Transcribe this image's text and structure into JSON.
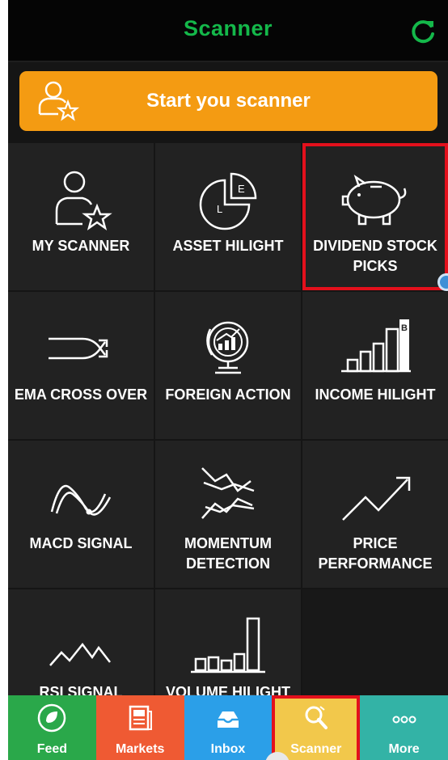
{
  "header": {
    "title": "Scanner",
    "refresh_icon": "refresh-icon"
  },
  "start_button": {
    "label": "Start you scanner",
    "icon": "user-star-icon"
  },
  "tiles": [
    {
      "id": "my-scanner",
      "label": "MY SCANNER",
      "icon": "user-star-icon"
    },
    {
      "id": "asset-hilight",
      "label": "ASSET HILIGHT",
      "icon": "pie-chart-icon"
    },
    {
      "id": "dividend-stock-picks",
      "label": "DIVIDEND STOCK PICKS",
      "icon": "piggy-bank-icon",
      "highlighted": true
    },
    {
      "id": "ema-cross-over",
      "label": "EMA CROSS OVER",
      "icon": "cross-arrows-icon"
    },
    {
      "id": "foreign-action",
      "label": "FOREIGN ACTION",
      "icon": "globe-chart-icon"
    },
    {
      "id": "income-hilight",
      "label": "INCOME HILIGHT",
      "icon": "bar-chart-icon"
    },
    {
      "id": "macd-signal",
      "label": "MACD SIGNAL",
      "icon": "sine-wave-icon"
    },
    {
      "id": "momentum-detection",
      "label": "MOMENTUM DETECTION",
      "icon": "momentum-icon"
    },
    {
      "id": "price-performance",
      "label": "PRICE PERFORMANCE",
      "icon": "trend-up-icon"
    },
    {
      "id": "rsi-signal",
      "label": "RSI SIGNAL",
      "icon": "zigzag-icon"
    },
    {
      "id": "volume-hilight",
      "label": "VOLUME HILIGHT",
      "icon": "volume-bars-icon"
    }
  ],
  "tabs": [
    {
      "label": "Feed",
      "icon": "leaf-icon",
      "color": "#2aa84a"
    },
    {
      "label": "Markets",
      "icon": "newspaper-icon",
      "color": "#ef5a33"
    },
    {
      "label": "Inbox",
      "icon": "inbox-icon",
      "color": "#2b9fe8"
    },
    {
      "label": "Scanner",
      "icon": "search-icon",
      "color": "#f2c84b",
      "active": true
    },
    {
      "label": "More",
      "icon": "more-dots-icon",
      "color": "#33b3a6"
    }
  ],
  "colors": {
    "accent": "#14b84a",
    "start_button": "#f49b12",
    "highlight": "#e3101c",
    "tile_bg": "#222222"
  }
}
